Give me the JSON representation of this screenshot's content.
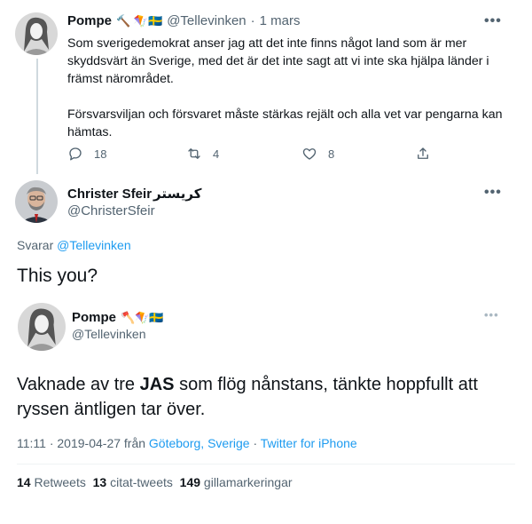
{
  "tweet1": {
    "name": "Pompe",
    "name_emoji": "🔨 🪁🇸🇪",
    "handle": "@Tellevinken",
    "separator": "·",
    "time": "1 mars",
    "paragraph1": "Som sverigedemokrat anser jag att det inte finns något land som är mer skyddsvärt än Sverige, med det är det inte sagt att vi inte ska hjälpa länder i främst närområdet.",
    "paragraph2": "Försvarsviljan och försvaret måste stärkas rejält och alla vet var pengarna kan hämtas.",
    "more": "•••",
    "replies": "18",
    "retweets": "4",
    "likes": "8",
    "icons": [
      "reply-icon",
      "retweet-icon",
      "like-icon",
      "share-icon"
    ]
  },
  "tweet2": {
    "name": "Christer Sfeir",
    "name_suffix": "كريستر",
    "handle": "@ChristerSfeir",
    "more": "•••",
    "reply_prefix": "Svarar",
    "reply_to": "@Tellevinken",
    "text": "This you?"
  },
  "quoted": {
    "name": "Pompe",
    "name_emoji": "🪓🪁🇸🇪",
    "handle": "@Tellevinken",
    "more": "•••",
    "text_before": "Vaknade av tre ",
    "text_bold": "JAS",
    "text_after": " som flög nånstans, tänkte hoppfullt att ryssen äntligen tar över.",
    "time": "11:11 · 2019-04-27 från",
    "location": "Göteborg, Sverige",
    "dot": "·",
    "source": "Twitter for iPhone",
    "retweets_count": "14",
    "retweets_label": "Retweets",
    "quotes_count": "13",
    "quotes_label": "citat-tweets",
    "likes_count": "149",
    "likes_label": "gillamarkeringar"
  }
}
